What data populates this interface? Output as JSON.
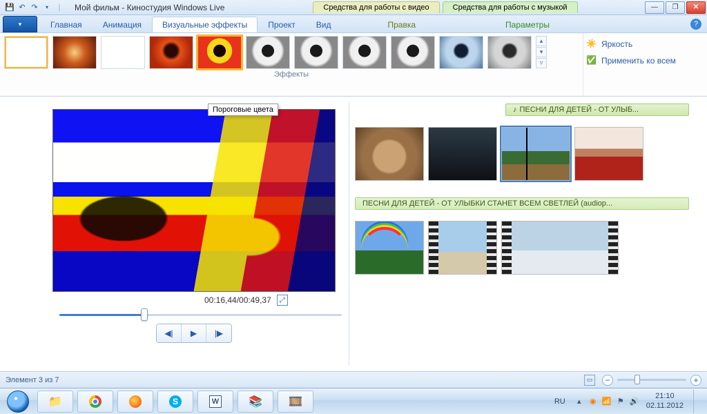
{
  "titlebar": {
    "app_title": "Мой фильм - Киностудия Windows Live",
    "context_video": "Средства для работы с видео",
    "context_music": "Средства для работы с музыкой"
  },
  "ribbon": {
    "tabs": {
      "home": "Главная",
      "animation": "Анимация",
      "visual_effects": "Визуальные эффекты",
      "project": "Проект",
      "view": "Вид",
      "edit": "Правка",
      "options": "Параметры"
    },
    "effects_group_label": "Эффекты",
    "brightness": "Яркость",
    "apply_all": "Применить ко всем",
    "tooltip_effect": "Пороговые цвета"
  },
  "preview": {
    "time": "00:16,44/00:49,37"
  },
  "timeline": {
    "music_label": "ПЕСНИ ДЛЯ ДЕТЕЙ - ОТ УЛЫБ...",
    "audio_label": "ПЕСНИ ДЛЯ ДЕТЕЙ - ОТ УЛЫБКИ СТАНЕТ ВСЕМ СВЕТЛЕЙ  (audiop..."
  },
  "status": {
    "element_counter": "Элемент 3 из 7"
  },
  "taskbar": {
    "lang": "RU",
    "time": "21:10",
    "date": "02.11.2012"
  }
}
